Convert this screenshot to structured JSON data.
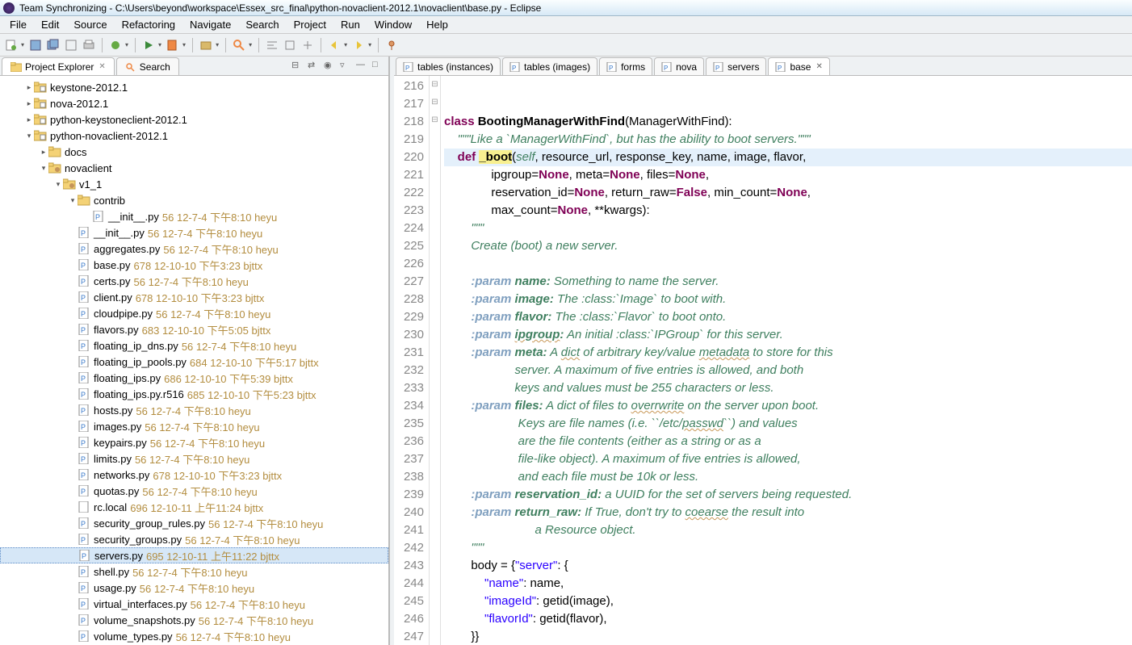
{
  "window": {
    "title": "Team Synchronizing - C:\\Users\\beyond\\workspace\\Essex_src_final\\python-novaclient-2012.1\\novaclient\\base.py - Eclipse"
  },
  "menu": [
    "File",
    "Edit",
    "Source",
    "Refactoring",
    "Navigate",
    "Search",
    "Project",
    "Run",
    "Window",
    "Help"
  ],
  "left_tabs": {
    "t1": "Project Explorer",
    "t2": "Search"
  },
  "editor_tabs": [
    {
      "label": "tables (instances)",
      "active": false
    },
    {
      "label": "tables (images)",
      "active": false
    },
    {
      "label": "forms",
      "active": false
    },
    {
      "label": "nova",
      "active": false
    },
    {
      "label": "servers",
      "active": false
    },
    {
      "label": "base",
      "active": true
    }
  ],
  "tree": {
    "projects": [
      {
        "name": "keystone-2012.1",
        "depth": 1,
        "type": "proj"
      },
      {
        "name": "nova-2012.1",
        "depth": 1,
        "type": "proj"
      },
      {
        "name": "python-keystoneclient-2012.1",
        "depth": 1,
        "type": "proj"
      },
      {
        "name": "python-novaclient-2012.1",
        "depth": 1,
        "type": "proj",
        "open": true
      },
      {
        "name": "docs",
        "depth": 2,
        "type": "folder"
      },
      {
        "name": "novaclient",
        "depth": 2,
        "type": "pkg",
        "open": true
      },
      {
        "name": "v1_1",
        "depth": 3,
        "type": "pkg",
        "open": true
      },
      {
        "name": "contrib",
        "depth": 4,
        "type": "folder",
        "open": true
      },
      {
        "name": "__init__.py",
        "meta": "56  12-7-4 下午8:10  heyu",
        "depth": 5,
        "type": "py"
      },
      {
        "name": "__init__.py",
        "meta": "56  12-7-4 下午8:10  heyu",
        "depth": 4,
        "type": "py"
      },
      {
        "name": "aggregates.py",
        "meta": "56  12-7-4 下午8:10  heyu",
        "depth": 4,
        "type": "py"
      },
      {
        "name": "base.py",
        "meta": "678  12-10-10 下午3:23  bjttx",
        "depth": 4,
        "type": "py"
      },
      {
        "name": "certs.py",
        "meta": "56  12-7-4 下午8:10  heyu",
        "depth": 4,
        "type": "py"
      },
      {
        "name": "client.py",
        "meta": "678  12-10-10 下午3:23  bjttx",
        "depth": 4,
        "type": "py"
      },
      {
        "name": "cloudpipe.py",
        "meta": "56  12-7-4 下午8:10  heyu",
        "depth": 4,
        "type": "py"
      },
      {
        "name": "flavors.py",
        "meta": "683  12-10-10 下午5:05  bjttx",
        "depth": 4,
        "type": "py"
      },
      {
        "name": "floating_ip_dns.py",
        "meta": "56  12-7-4 下午8:10  heyu",
        "depth": 4,
        "type": "py"
      },
      {
        "name": "floating_ip_pools.py",
        "meta": "684  12-10-10 下午5:17  bjttx",
        "depth": 4,
        "type": "py"
      },
      {
        "name": "floating_ips.py",
        "meta": "686  12-10-10 下午5:39  bjttx",
        "depth": 4,
        "type": "py"
      },
      {
        "name": "floating_ips.py.r516",
        "meta": "685  12-10-10 下午5:23  bjttx",
        "depth": 4,
        "type": "py"
      },
      {
        "name": "hosts.py",
        "meta": "56  12-7-4 下午8:10  heyu",
        "depth": 4,
        "type": "py"
      },
      {
        "name": "images.py",
        "meta": "56  12-7-4 下午8:10  heyu",
        "depth": 4,
        "type": "py"
      },
      {
        "name": "keypairs.py",
        "meta": "56  12-7-4 下午8:10  heyu",
        "depth": 4,
        "type": "py"
      },
      {
        "name": "limits.py",
        "meta": "56  12-7-4 下午8:10  heyu",
        "depth": 4,
        "type": "py"
      },
      {
        "name": "networks.py",
        "meta": "678  12-10-10 下午3:23  bjttx",
        "depth": 4,
        "type": "py"
      },
      {
        "name": "quotas.py",
        "meta": "56  12-7-4 下午8:10  heyu",
        "depth": 4,
        "type": "py"
      },
      {
        "name": "rc.local",
        "meta": "696  12-10-11 上午11:24  bjttx",
        "depth": 4,
        "type": "file"
      },
      {
        "name": "security_group_rules.py",
        "meta": "56  12-7-4 下午8:10  heyu",
        "depth": 4,
        "type": "py"
      },
      {
        "name": "security_groups.py",
        "meta": "56  12-7-4 下午8:10  heyu",
        "depth": 4,
        "type": "py"
      },
      {
        "name": "servers.py",
        "meta": "695  12-10-11 上午11:22  bjttx",
        "depth": 4,
        "type": "py",
        "selected": true
      },
      {
        "name": "shell.py",
        "meta": "56  12-7-4 下午8:10  heyu",
        "depth": 4,
        "type": "py"
      },
      {
        "name": "usage.py",
        "meta": "56  12-7-4 下午8:10  heyu",
        "depth": 4,
        "type": "py"
      },
      {
        "name": "virtual_interfaces.py",
        "meta": "56  12-7-4 下午8:10  heyu",
        "depth": 4,
        "type": "py"
      },
      {
        "name": "volume_snapshots.py",
        "meta": "56  12-7-4 下午8:10  heyu",
        "depth": 4,
        "type": "py"
      },
      {
        "name": "volume_types.py",
        "meta": "56  12-7-4 下午8:10  heyu",
        "depth": 4,
        "type": "py"
      }
    ]
  },
  "code": {
    "first_line": 216,
    "lines": [
      "",
      "",
      "<span class='kw'>class</span> <span class='fn'>BootingManagerWithFind</span>(ManagerWithFind):",
      "    <span class='doc'>\"\"\"Like a `ManagerWithFind`, but has the ability to boot servers.\"\"\"</span>",
      "    <span class='kw'>def</span> <span class='sel fn'>_boot</span>(<span class='doc'>self</span>, resource_url, response_key, name, image, flavor,",
      "              ipgroup=<span class='kw'>None</span>, meta=<span class='kw'>None</span>, files=<span class='kw'>None</span>,",
      "              reservation_id=<span class='kw'>None</span>, return_raw=<span class='kw'>False</span>, min_count=<span class='kw'>None</span>,",
      "              max_count=<span class='kw'>None</span>, **kwargs):",
      "        <span class='doc'>\"\"\"</span>",
      "<span class='doc'>        Create (boot) a new server.</span>",
      "",
      "<span class='doc'>        </span><span class='doct'>:param</span><span class='docb'> name:</span><span class='doc'> Something to name the server.</span>",
      "<span class='doc'>        </span><span class='doct'>:param</span><span class='docb'> image:</span><span class='doc'> The :class:`Image` to boot with.</span>",
      "<span class='doc'>        </span><span class='doct'>:param</span><span class='docb'> flavor:</span><span class='doc'> The :class:`Flavor` to boot onto.</span>",
      "<span class='doc'>        </span><span class='doct'>:param</span><span class='docb'> <span class='underln'>ipgroup</span>:</span><span class='doc'> An initial :class:`IPGroup` for this server.</span>",
      "<span class='doc'>        </span><span class='doct'>:param</span><span class='docb'> meta:</span><span class='doc'> A <span class='underln'>dict</span> of arbitrary key/value <span class='underln'>metadata</span> to store for this</span>",
      "<span class='doc'>                     server. A maximum of five entries is allowed, and both</span>",
      "<span class='doc'>                     keys and values must be 255 characters or less.</span>",
      "<span class='doc'>        </span><span class='doct'>:param</span><span class='docb'> files:</span><span class='doc'> A dict of files to <span class='underln'>overrwrite</span> on the server upon boot.</span>",
      "<span class='doc'>                      Keys are file names (i.e. ``/etc/<span class='underln'>passwd</span>``) and values</span>",
      "<span class='doc'>                      are the file contents (either as a string or as a</span>",
      "<span class='doc'>                      file-like object). A maximum of five entries is allowed,</span>",
      "<span class='doc'>                      and each file must be 10k or less.</span>",
      "<span class='doc'>        </span><span class='doct'>:param</span><span class='docb'> reservation_id:</span><span class='doc'> a UUID for the set of servers being requested.</span>",
      "<span class='doc'>        </span><span class='doct'>:param</span><span class='docb'> return_raw:</span><span class='doc'> If True, don't try to <span class='underln'>coearse</span> the result into</span>",
      "<span class='doc'>                           a Resource object.</span>",
      "        <span class='doc'>\"\"\"</span>",
      "        body = {<span class='str'>\"server\"</span>: {",
      "            <span class='str'>\"name\"</span>: name,",
      "            <span class='str'>\"imageId\"</span>: getid(image),",
      "            <span class='str'>\"flavorId\"</span>: getid(flavor),",
      "        }}"
    ],
    "fold_marks": {
      "218": "⊟",
      "220": "⊟",
      "224": "⊟"
    }
  }
}
